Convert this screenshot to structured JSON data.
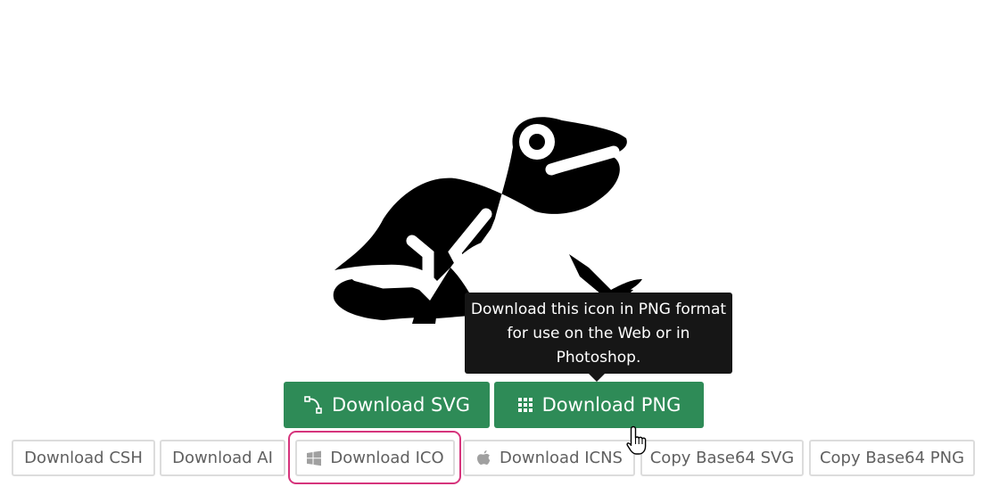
{
  "icon": {
    "name": "frog-icon"
  },
  "tooltip": {
    "line1": "Download this icon in PNG format",
    "line2": "for use on the Web or in",
    "line3": "Photoshop."
  },
  "primary_buttons": {
    "svg_label": "Download SVG",
    "png_label": "Download PNG",
    "color": "#2e8b57"
  },
  "secondary_buttons": {
    "csh_label": "Download CSH",
    "ai_label": "Download AI",
    "ico_label": "Download ICO",
    "icns_label": "Download ICNS",
    "b64svg_label": "Copy Base64 SVG",
    "b64png_label": "Copy Base64 PNG"
  },
  "focus_ring_color": "#d6347c"
}
